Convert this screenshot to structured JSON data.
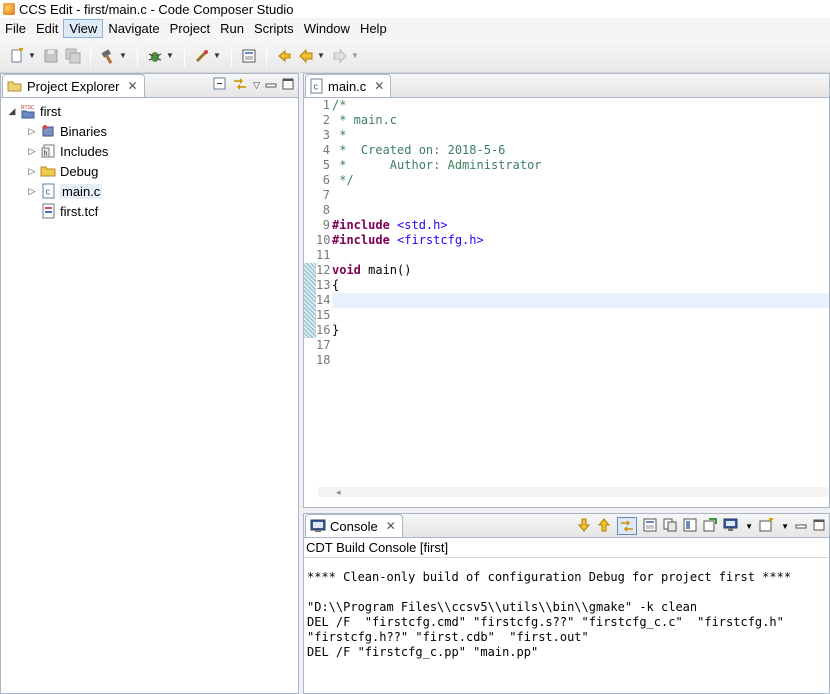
{
  "window": {
    "title": "CCS Edit - first/main.c - Code Composer Studio"
  },
  "menubar": {
    "items": [
      "File",
      "Edit",
      "View",
      "Navigate",
      "Project",
      "Run",
      "Scripts",
      "Window",
      "Help"
    ],
    "active": "View"
  },
  "project_explorer": {
    "tab_label": "Project Explorer",
    "root": {
      "label": "first",
      "icon": "rtsc-project-icon"
    },
    "items": [
      {
        "label": "Binaries",
        "icon": "binaries-icon",
        "expandable": true
      },
      {
        "label": "Includes",
        "icon": "includes-icon",
        "expandable": true
      },
      {
        "label": "Debug",
        "icon": "folder-icon",
        "expandable": true
      },
      {
        "label": "main.c",
        "icon": "c-file-icon",
        "expandable": true
      },
      {
        "label": "first.tcf",
        "icon": "tcf-file-icon",
        "expandable": false
      }
    ]
  },
  "editor": {
    "tab_label": "main.c",
    "lines": [
      {
        "n": "1",
        "text": "/*",
        "kind": "comment"
      },
      {
        "n": "2",
        "text": " * main.c",
        "kind": "comment"
      },
      {
        "n": "3",
        "text": " *",
        "kind": "comment"
      },
      {
        "n": "4",
        "text": " *  Created on: 2018-5-6",
        "kind": "comment"
      },
      {
        "n": "5",
        "text": " *      Author: Administrator",
        "kind": "comment"
      },
      {
        "n": "6",
        "text": " */",
        "kind": "comment"
      },
      {
        "n": "7",
        "text": "",
        "kind": "plain"
      },
      {
        "n": "8",
        "text": "",
        "kind": "plain"
      },
      {
        "n": "9",
        "kw": "#include",
        "rest": " <std.h>",
        "kind": "include"
      },
      {
        "n": "10",
        "kw": "#include",
        "rest": " <firstcfg.h>",
        "kind": "include"
      },
      {
        "n": "11",
        "text": "",
        "kind": "plain"
      },
      {
        "n": "12",
        "kw": "void",
        "rest": " main()",
        "kind": "keyword"
      },
      {
        "n": "13",
        "text": "{",
        "kind": "plain"
      },
      {
        "n": "14",
        "text": "",
        "kind": "plain",
        "current": true
      },
      {
        "n": "15",
        "text": "",
        "kind": "plain"
      },
      {
        "n": "16",
        "text": "}",
        "kind": "plain"
      },
      {
        "n": "17",
        "text": "",
        "kind": "plain"
      },
      {
        "n": "18",
        "text": "",
        "kind": "plain"
      }
    ]
  },
  "console": {
    "tab_label": "Console",
    "header": "CDT Build Console [first]",
    "lines": [
      "**** Clean-only build of configuration Debug for project first ****",
      "",
      "\"D:\\\\Program Files\\\\ccsv5\\\\utils\\\\bin\\\\gmake\" -k clean",
      "DEL /F  \"firstcfg.cmd\" \"firstcfg.s??\" \"firstcfg_c.c\"  \"firstcfg.h\"",
      "\"firstcfg.h??\" \"first.cdb\"  \"first.out\"",
      "DEL /F \"firstcfg_c.pp\" \"main.pp\""
    ]
  }
}
